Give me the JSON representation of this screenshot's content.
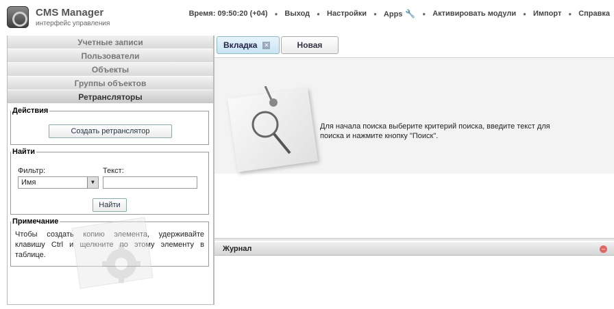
{
  "header": {
    "title": "CMS Manager",
    "subtitle": "интерфейс управления",
    "nav": [
      {
        "label": "Время: 09:50:20 (+04)"
      },
      {
        "label": "Выход"
      },
      {
        "label": "Настройки"
      },
      {
        "label": "Apps"
      },
      {
        "label": "Активировать модули"
      },
      {
        "label": "Импорт"
      },
      {
        "label": "Справка"
      }
    ]
  },
  "sidebar": {
    "items": [
      {
        "label": "Учетные записи"
      },
      {
        "label": "Пользователи"
      },
      {
        "label": "Объекты"
      },
      {
        "label": "Группы объектов"
      },
      {
        "label": "Ретрансляторы"
      }
    ]
  },
  "actions": {
    "legend": "Действия",
    "create_button": "Создать ретранслятор"
  },
  "search": {
    "legend": "Найти",
    "filter_label": "Фильтр:",
    "filter_value": "Имя",
    "text_label": "Текст:",
    "text_value": "",
    "find_button": "Найти"
  },
  "note": {
    "legend": "Примечание",
    "text": "Чтобы создать копию элемента, удерживайте клавишу Ctrl и щелкните по этому элементу в таблице."
  },
  "tabs": [
    {
      "label": "Вкладка"
    },
    {
      "label": "Новая"
    }
  ],
  "main": {
    "hint": "Для начала поиска выберите критерий поиска, введите текст для поиска и нажмите кнопку \"Поиск\"."
  },
  "journal": {
    "title": "Журнал"
  }
}
